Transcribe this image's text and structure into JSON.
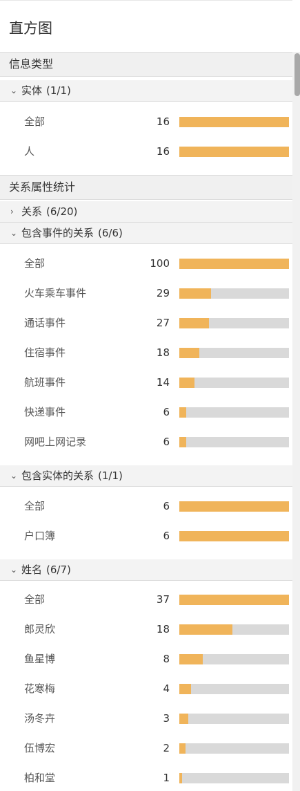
{
  "title": "直方图",
  "accent_color": "#f0b45a",
  "track_color": "#d9d9d9",
  "headers": {
    "info_type": "信息类型",
    "relation_stats": "关系属性统计"
  },
  "sections": {
    "entity": {
      "label": "实体",
      "count": "(1/1)",
      "expanded": true
    },
    "relation": {
      "label": "关系",
      "count": "(6/20)",
      "expanded": false
    },
    "event_relation": {
      "label": "包含事件的关系",
      "count": "(6/6)",
      "expanded": true
    },
    "entity_relation": {
      "label": "包含实体的关系",
      "count": "(1/1)",
      "expanded": true
    },
    "name": {
      "label": "姓名",
      "count": "(6/7)",
      "expanded": true
    }
  },
  "rows": {
    "entity": [
      {
        "label": "全部",
        "count": "16",
        "fraction": 1.0
      },
      {
        "label": "人",
        "count": "16",
        "fraction": 1.0
      }
    ],
    "event_relation": [
      {
        "label": "全部",
        "count": "100",
        "fraction": 1.0
      },
      {
        "label": "火车乘车事件",
        "count": "29",
        "fraction": 0.29
      },
      {
        "label": "通话事件",
        "count": "27",
        "fraction": 0.27
      },
      {
        "label": "住宿事件",
        "count": "18",
        "fraction": 0.18
      },
      {
        "label": "航班事件",
        "count": "14",
        "fraction": 0.14
      },
      {
        "label": "快递事件",
        "count": "6",
        "fraction": 0.06
      },
      {
        "label": "网吧上网记录",
        "count": "6",
        "fraction": 0.06
      }
    ],
    "entity_relation": [
      {
        "label": "全部",
        "count": "6",
        "fraction": 1.0
      },
      {
        "label": "户口簿",
        "count": "6",
        "fraction": 1.0
      }
    ],
    "name": [
      {
        "label": "全部",
        "count": "37",
        "fraction": 1.0
      },
      {
        "label": "郎灵欣",
        "count": "18",
        "fraction": 0.486
      },
      {
        "label": "鱼星博",
        "count": "8",
        "fraction": 0.216
      },
      {
        "label": "花寒梅",
        "count": "4",
        "fraction": 0.108
      },
      {
        "label": "汤冬卉",
        "count": "3",
        "fraction": 0.081
      },
      {
        "label": "伍博宏",
        "count": "2",
        "fraction": 0.054
      },
      {
        "label": "柏和堂",
        "count": "1",
        "fraction": 0.027
      }
    ]
  }
}
